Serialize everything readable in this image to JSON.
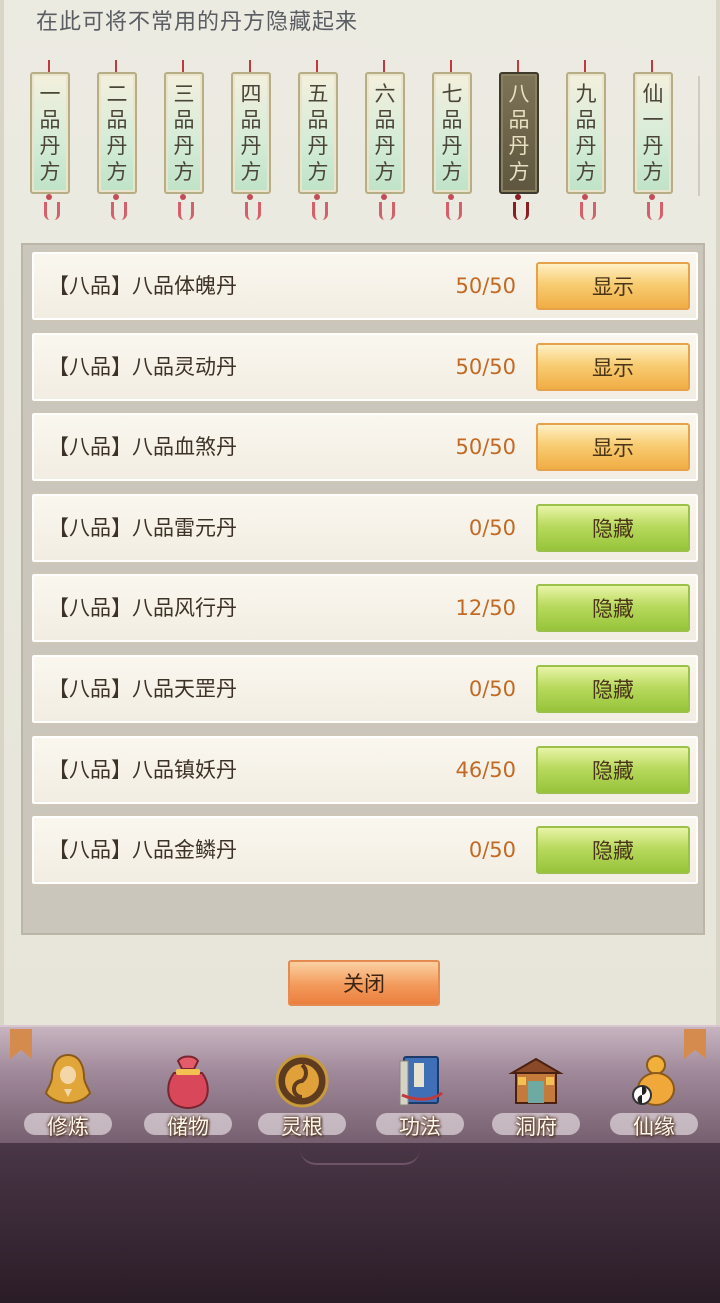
{
  "hint_text": "在此可将不常用的丹方隐藏起来",
  "tabs": [
    {
      "chars": [
        "一",
        "品",
        "丹",
        "方"
      ],
      "active": false
    },
    {
      "chars": [
        "二",
        "品",
        "丹",
        "方"
      ],
      "active": false
    },
    {
      "chars": [
        "三",
        "品",
        "丹",
        "方"
      ],
      "active": false
    },
    {
      "chars": [
        "四",
        "品",
        "丹",
        "方"
      ],
      "active": false
    },
    {
      "chars": [
        "五",
        "品",
        "丹",
        "方"
      ],
      "active": false
    },
    {
      "chars": [
        "六",
        "品",
        "丹",
        "方"
      ],
      "active": false
    },
    {
      "chars": [
        "七",
        "品",
        "丹",
        "方"
      ],
      "active": false
    },
    {
      "chars": [
        "八",
        "品",
        "丹",
        "方"
      ],
      "active": true
    },
    {
      "chars": [
        "九",
        "品",
        "丹",
        "方"
      ],
      "active": false
    },
    {
      "chars": [
        "仙",
        "一",
        "丹",
        "方"
      ],
      "active": false
    }
  ],
  "recipes": [
    {
      "name": "【八品】八品体魄丹",
      "count": "50/50",
      "action": "显示",
      "state": "show"
    },
    {
      "name": "【八品】八品灵动丹",
      "count": "50/50",
      "action": "显示",
      "state": "show"
    },
    {
      "name": "【八品】八品血煞丹",
      "count": "50/50",
      "action": "显示",
      "state": "show"
    },
    {
      "name": "【八品】八品雷元丹",
      "count": "0/50",
      "action": "隐藏",
      "state": "hide"
    },
    {
      "name": "【八品】八品风行丹",
      "count": "12/50",
      "action": "隐藏",
      "state": "hide"
    },
    {
      "name": "【八品】八品天罡丹",
      "count": "0/50",
      "action": "隐藏",
      "state": "hide"
    },
    {
      "name": "【八品】八品镇妖丹",
      "count": "46/50",
      "action": "隐藏",
      "state": "hide"
    },
    {
      "name": "【八品】八品金鳞丹",
      "count": "0/50",
      "action": "隐藏",
      "state": "hide"
    }
  ],
  "close_label": "关闭",
  "nav": [
    {
      "label": "修炼",
      "icon": "cultivate-icon"
    },
    {
      "label": "储物",
      "icon": "storage-bag-icon"
    },
    {
      "label": "灵根",
      "icon": "spirit-root-icon"
    },
    {
      "label": "功法",
      "icon": "skill-book-icon"
    },
    {
      "label": "洞府",
      "icon": "cave-residence-icon"
    },
    {
      "label": "仙缘",
      "icon": "immortal-gourd-icon"
    }
  ],
  "colors": {
    "count_orange": "#c26a24",
    "show_button": "#f0ad45",
    "hide_button": "#97c43b",
    "close_button": "#ea7f3f",
    "active_tab": "#5e563f"
  }
}
